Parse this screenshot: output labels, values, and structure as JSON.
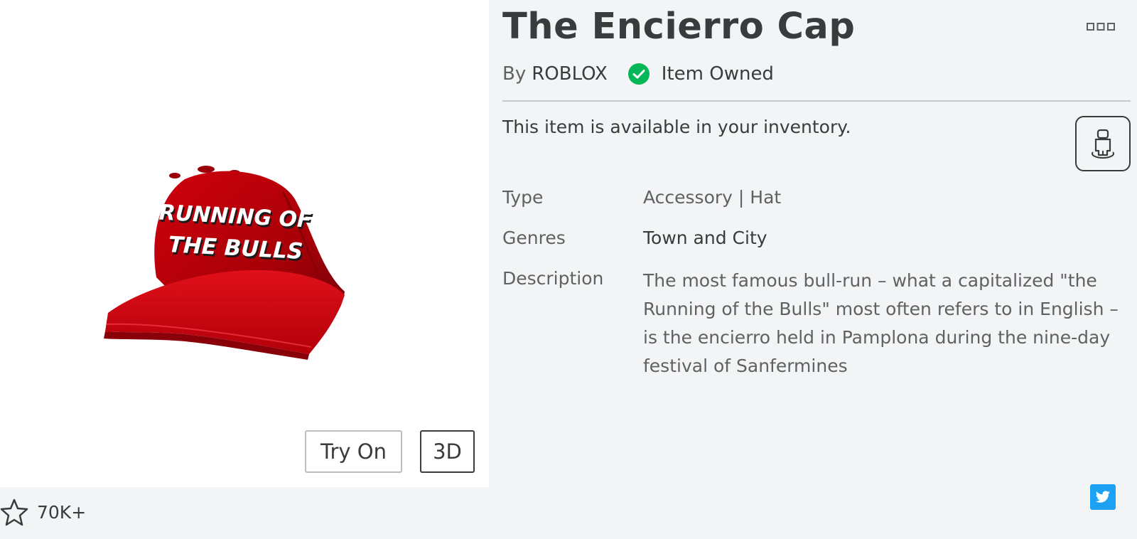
{
  "item": {
    "title": "The Encierro Cap",
    "by_label": "By",
    "creator": "ROBLOX",
    "owned_label": "Item Owned",
    "availability": "This item is available in your inventory.",
    "image_text_line1": "RUNNING OF",
    "image_text_line2": "THE BULLS"
  },
  "details": {
    "type_label": "Type",
    "type_value": "Accessory | Hat",
    "genres_label": "Genres",
    "genres_value": "Town and City",
    "description_label": "Description",
    "description_value": "The most famous bull-run – what a capitalized \"the Running of the Bulls\" most often refers to in English – is the encierro held in Pamplona during the nine-day festival of Sanfermines"
  },
  "buttons": {
    "try_on": "Try On",
    "view_3d": "3D"
  },
  "favorites": {
    "count": "70K+"
  },
  "icons": {
    "owned": "check-circle-icon",
    "more": "more-options-icon",
    "avatar": "avatar-preview-icon",
    "favorite": "star-icon",
    "share": "twitter-icon"
  },
  "colors": {
    "owned_green": "#02b757",
    "twitter_blue": "#1da1f2",
    "hat_red": "#c8000a"
  }
}
